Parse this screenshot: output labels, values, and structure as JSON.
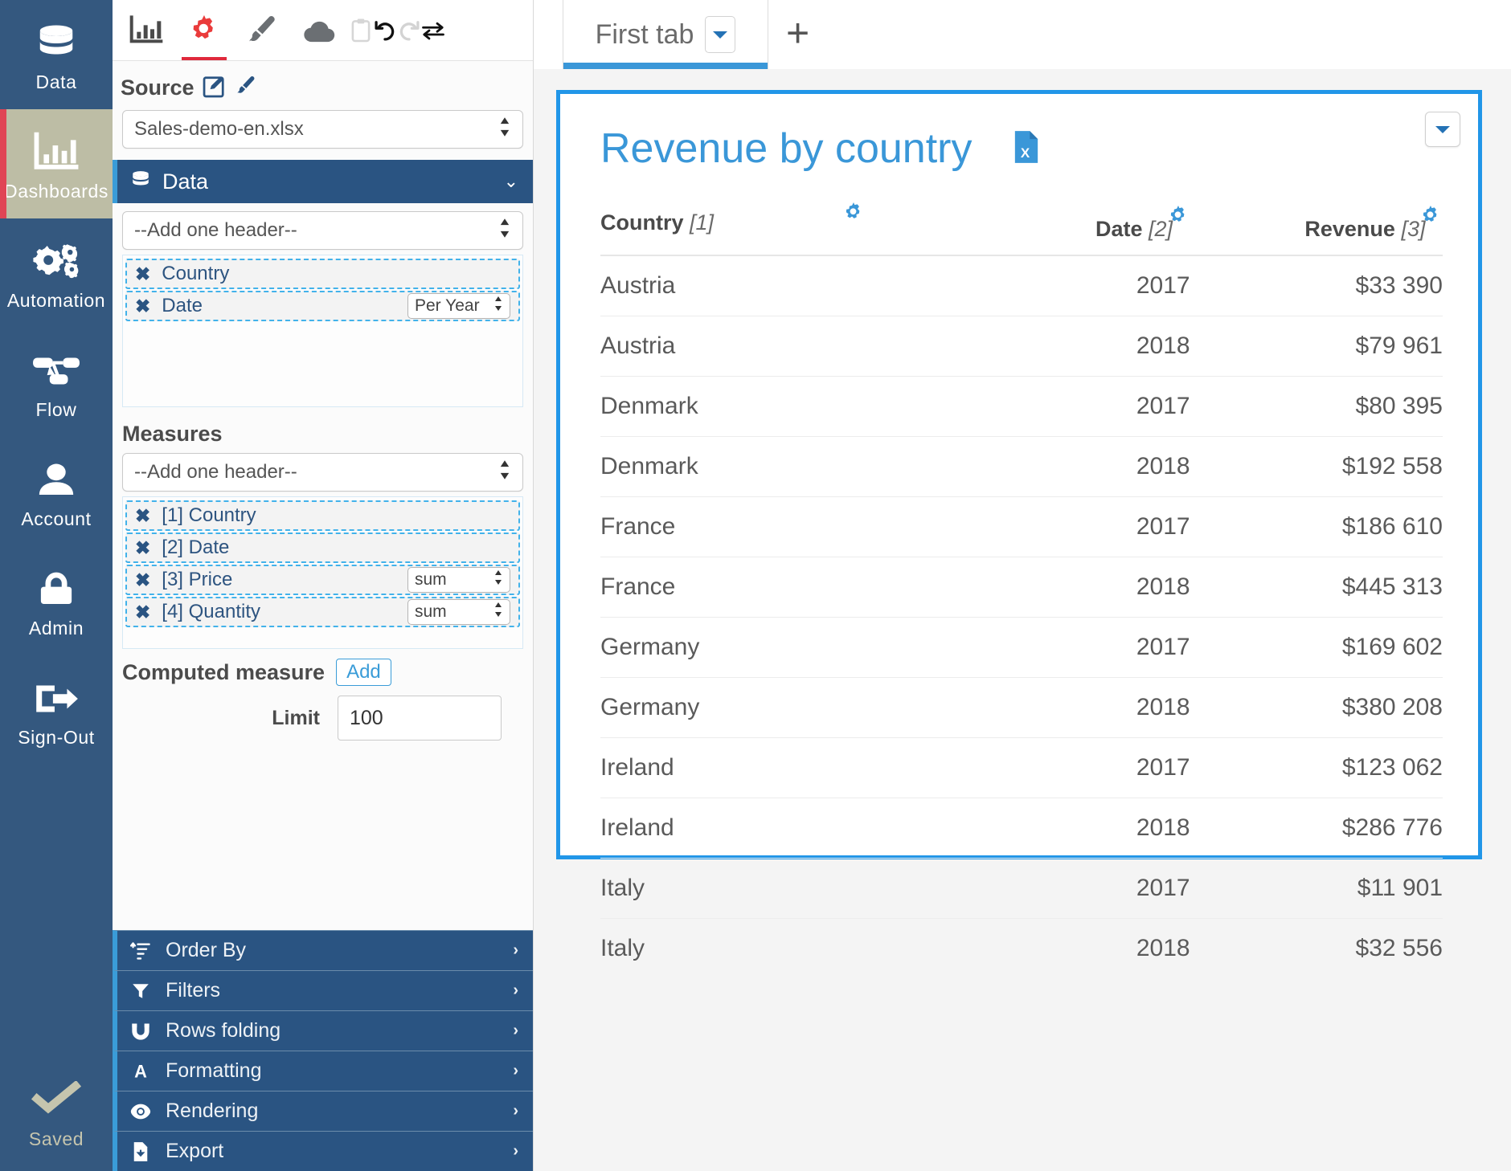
{
  "rail": {
    "items": [
      {
        "label": "Data",
        "icon": "database-icon",
        "active": false
      },
      {
        "label": "Dashboards",
        "icon": "bar-chart-icon",
        "active": true
      },
      {
        "label": "Automation",
        "icon": "gears-icon",
        "active": false
      },
      {
        "label": "Flow",
        "icon": "flow-icon",
        "active": false
      },
      {
        "label": "Account",
        "icon": "user-icon",
        "active": false
      },
      {
        "label": "Admin",
        "icon": "lock-icon",
        "active": false
      },
      {
        "label": "Sign-Out",
        "icon": "sign-out-icon",
        "active": false
      }
    ],
    "status": {
      "label": "Saved",
      "icon": "check-icon"
    }
  },
  "panel": {
    "tabs": [
      {
        "name": "chart-tab",
        "icon": "bar-chart-icon",
        "active": false
      },
      {
        "name": "settings-tab",
        "icon": "gear-icon",
        "active": true
      },
      {
        "name": "style-tab",
        "icon": "paintbrush-icon",
        "active": false
      },
      {
        "name": "cloud-tab",
        "icon": "cloud-icon",
        "active": false
      },
      {
        "name": "clipboard-tab",
        "icon": "clipboard-icon",
        "active": false
      },
      {
        "name": "undo-tab",
        "icon": "undo-icon",
        "active": false
      },
      {
        "name": "redo-tab",
        "icon": "redo-icon",
        "active": false
      },
      {
        "name": "swap-tab",
        "icon": "swap-arrows-icon",
        "active": false
      }
    ],
    "source": {
      "title": "Source",
      "edit_icon": "edit-square-icon",
      "brush_icon": "paintbrush-icon",
      "selected": "Sales-demo-en.xlsx"
    },
    "data_section": {
      "title": "Data",
      "icon": "database-icon",
      "chevron": "chevron-down-icon",
      "add_header_placeholder": "--Add one header--",
      "chips": [
        {
          "label": "Country",
          "option": null
        },
        {
          "label": "Date",
          "option": "Per Year"
        }
      ]
    },
    "measures_section": {
      "title": "Measures",
      "add_header_placeholder": "--Add one header--",
      "chips": [
        {
          "label": "[1] Country",
          "option": null
        },
        {
          "label": "[2] Date",
          "option": null
        },
        {
          "label": "[3] Price",
          "option": "sum"
        },
        {
          "label": "[4] Quantity",
          "option": "sum"
        }
      ]
    },
    "computed_measure": {
      "label": "Computed measure",
      "add_label": "Add"
    },
    "limit": {
      "label": "Limit",
      "value": "100"
    },
    "accordion": [
      {
        "label": "Order By",
        "icon": "sort-icon",
        "arrow": "chevron-right-icon"
      },
      {
        "label": "Filters",
        "icon": "funnel-icon",
        "arrow": "chevron-right-icon"
      },
      {
        "label": "Rows folding",
        "icon": "magnet-icon",
        "arrow": "chevron-right-icon"
      },
      {
        "label": "Formatting",
        "icon": "letter-a-icon",
        "arrow": "chevron-right-icon"
      },
      {
        "label": "Rendering",
        "icon": "eye-icon",
        "arrow": "chevron-right-icon"
      },
      {
        "label": "Export",
        "icon": "file-download-icon",
        "arrow": "chevron-right-icon"
      }
    ]
  },
  "main": {
    "tabs": [
      {
        "label": "First tab",
        "active": true,
        "caret": "caret-down-icon"
      }
    ],
    "add_tab_label": "+",
    "card": {
      "menu_icon": "caret-down-icon",
      "title": "Revenue by country",
      "export_icon": "excel-file-icon",
      "columns": [
        {
          "label": "Country",
          "index": "[1]",
          "gear": "gear-icon"
        },
        {
          "label": "Date",
          "index": "[2]",
          "gear": "gear-icon"
        },
        {
          "label": "Revenue",
          "index": "[3]",
          "gear": "gear-icon"
        }
      ],
      "rows": [
        {
          "country": "Austria",
          "date": "2017",
          "revenue": "$33 390"
        },
        {
          "country": "Austria",
          "date": "2018",
          "revenue": "$79 961"
        },
        {
          "country": "Denmark",
          "date": "2017",
          "revenue": "$80 395"
        },
        {
          "country": "Denmark",
          "date": "2018",
          "revenue": "$192 558"
        },
        {
          "country": "France",
          "date": "2017",
          "revenue": "$186 610"
        },
        {
          "country": "France",
          "date": "2018",
          "revenue": "$445 313"
        },
        {
          "country": "Germany",
          "date": "2017",
          "revenue": "$169 602"
        },
        {
          "country": "Germany",
          "date": "2018",
          "revenue": "$380 208"
        },
        {
          "country": "Ireland",
          "date": "2017",
          "revenue": "$123 062"
        },
        {
          "country": "Ireland",
          "date": "2018",
          "revenue": "$286 776"
        },
        {
          "country": "Italy",
          "date": "2017",
          "revenue": "$11 901"
        },
        {
          "country": "Italy",
          "date": "2018",
          "revenue": "$32 556"
        }
      ]
    }
  },
  "colors": {
    "rail_bg": "#34587f",
    "rail_active_bg": "#bdbda5",
    "rail_active_marker": "#e04455",
    "accent_blue": "#3a97d8",
    "card_border": "#2196e8",
    "section_blue": "#2a5482",
    "tab_active_red": "#e0293c"
  }
}
